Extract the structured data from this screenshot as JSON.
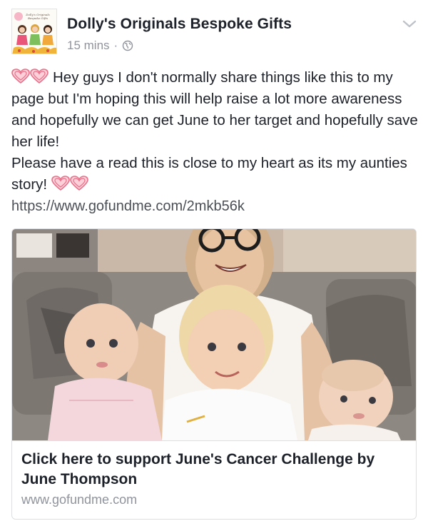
{
  "post": {
    "page_name": "Dolly's Originals Bespoke Gifts",
    "timestamp": "15 mins",
    "privacy_icon": "globe-icon",
    "menu_icon": "chevron-down-icon",
    "avatar_text": "Dolly's Originals Bespoke Gifts",
    "text": {
      "line1": "Hey guys I don't normally share things like this to my page but I'm hoping this will help raise a lot more awareness and hopefully we can get June to her target and hopefully save her life!",
      "line2": "Please have a read this is close to my heart as its my aunties story!"
    },
    "emoji": "revolving-hearts",
    "link": "https://www.gofundme.com/2mkb56k"
  },
  "card": {
    "title": "Click here to support June's Cancer Challenge by June Thompson",
    "domain": "www.gofundme.com"
  },
  "colors": {
    "text": "#1d2129",
    "meta": "#90949c",
    "heart": "#f28a9e",
    "border": "#dddfe2"
  }
}
